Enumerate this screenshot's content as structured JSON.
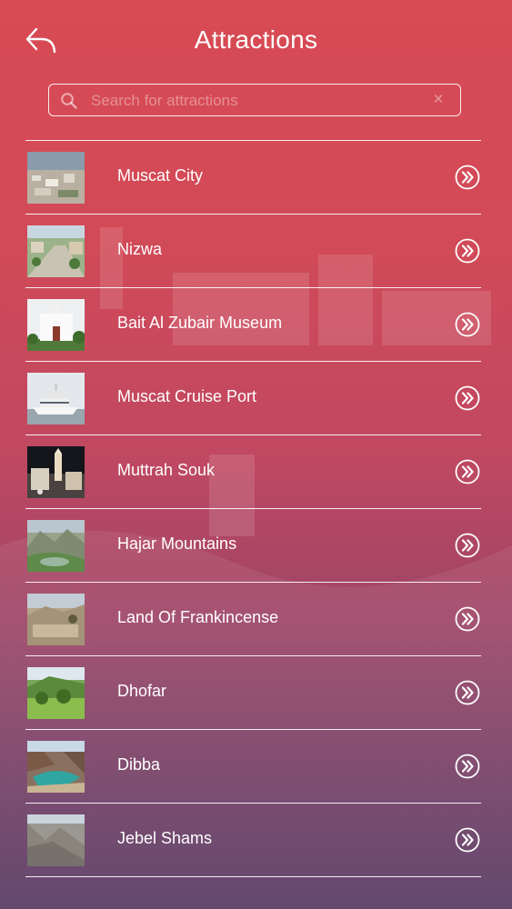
{
  "header": {
    "title": "Attractions",
    "back_icon": "back-arrow-icon"
  },
  "search": {
    "placeholder": "Search for attractions",
    "value": "",
    "search_icon": "search-icon",
    "clear_icon": "clear-icon",
    "clear_symbol": "×"
  },
  "colors": {
    "gradient_top": "#d84a54",
    "gradient_bottom": "#573a63",
    "text": "#ffffff"
  },
  "attractions": [
    {
      "label": "Muscat City",
      "icon": "chevron-double-right-icon"
    },
    {
      "label": "Nizwa",
      "icon": "chevron-double-right-icon"
    },
    {
      "label": "Bait Al Zubair Museum",
      "icon": "chevron-double-right-icon"
    },
    {
      "label": "Muscat Cruise Port",
      "icon": "chevron-double-right-icon"
    },
    {
      "label": "Muttrah Souk",
      "icon": "chevron-double-right-icon"
    },
    {
      "label": "Hajar Mountains",
      "icon": "chevron-double-right-icon"
    },
    {
      "label": "Land Of Frankincense",
      "icon": "chevron-double-right-icon"
    },
    {
      "label": "Dhofar",
      "icon": "chevron-double-right-icon"
    },
    {
      "label": "Dibba",
      "icon": "chevron-double-right-icon"
    },
    {
      "label": "Jebel Shams",
      "icon": "chevron-double-right-icon"
    }
  ]
}
